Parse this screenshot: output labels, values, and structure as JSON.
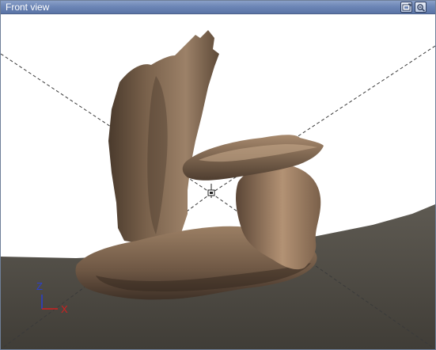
{
  "window": {
    "title": "Front view"
  },
  "titlebar_buttons": [
    {
      "icon": "view-options-icon"
    },
    {
      "icon": "maximize-view-icon"
    }
  ],
  "axes": {
    "z_label": "Z",
    "x_label": "X",
    "z_color": "#2a3fcf",
    "x_color": "#d02020"
  },
  "colors": {
    "background": "#ffffff",
    "ground": "#4f4b44",
    "model": "#8a6f58",
    "title_bar": "#6d86b6"
  }
}
